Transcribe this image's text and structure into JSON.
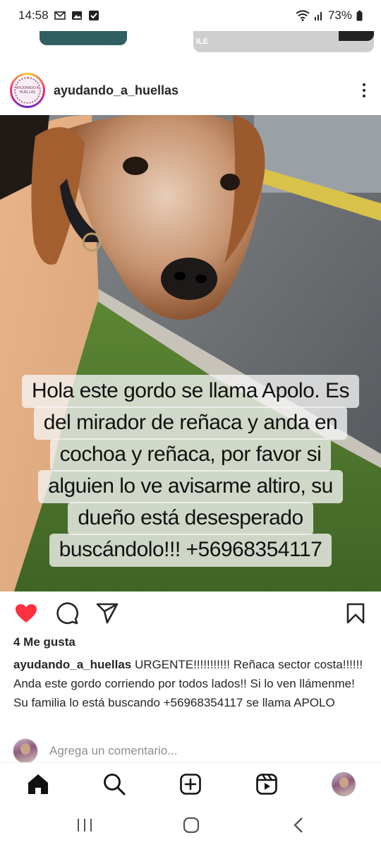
{
  "status_bar": {
    "time": "14:58",
    "battery": "73%",
    "left_icons": [
      "gmail-icon",
      "gallery-icon",
      "check-icon"
    ],
    "right_icons": [
      "wifi-icon",
      "signal-icon",
      "battery-icon"
    ]
  },
  "prev_post": {
    "tag_text": "ILE"
  },
  "post": {
    "username": "ayudando_a_huellas",
    "avatar_text": "AYUDANDO A HUELLAS",
    "overlay_lines": [
      "Hola este gordo se llama Apolo. Es",
      "del mirador de reñaca y anda en",
      "cochoa y reñaca, por favor si",
      "alguien lo ve avisarme altiro, su",
      "dueño está desesperado",
      "buscándolo!!! +56968354117"
    ],
    "likes": "4 Me gusta",
    "caption_user": "ayudando_a_huellas",
    "caption_text": " URGENTE!!!!!!!!!!! Reñaca sector costa!!!!!! Anda este gordo corriendo por todos lados!! Si lo ven llámenme! Su familia lo está buscando +56968354117 se llama APOLO",
    "comment_placeholder": "Agrega un comentario..."
  },
  "actions": {
    "like_active_color": "#ff3040",
    "icons": [
      "heart-icon",
      "comment-icon",
      "share-icon",
      "save-icon"
    ]
  },
  "bottom_nav": {
    "icons": [
      "home-icon",
      "search-icon",
      "create-icon",
      "reels-icon",
      "profile-avatar"
    ]
  },
  "system_nav": {
    "icons": [
      "recents-icon",
      "home-circle-icon",
      "back-icon"
    ]
  }
}
